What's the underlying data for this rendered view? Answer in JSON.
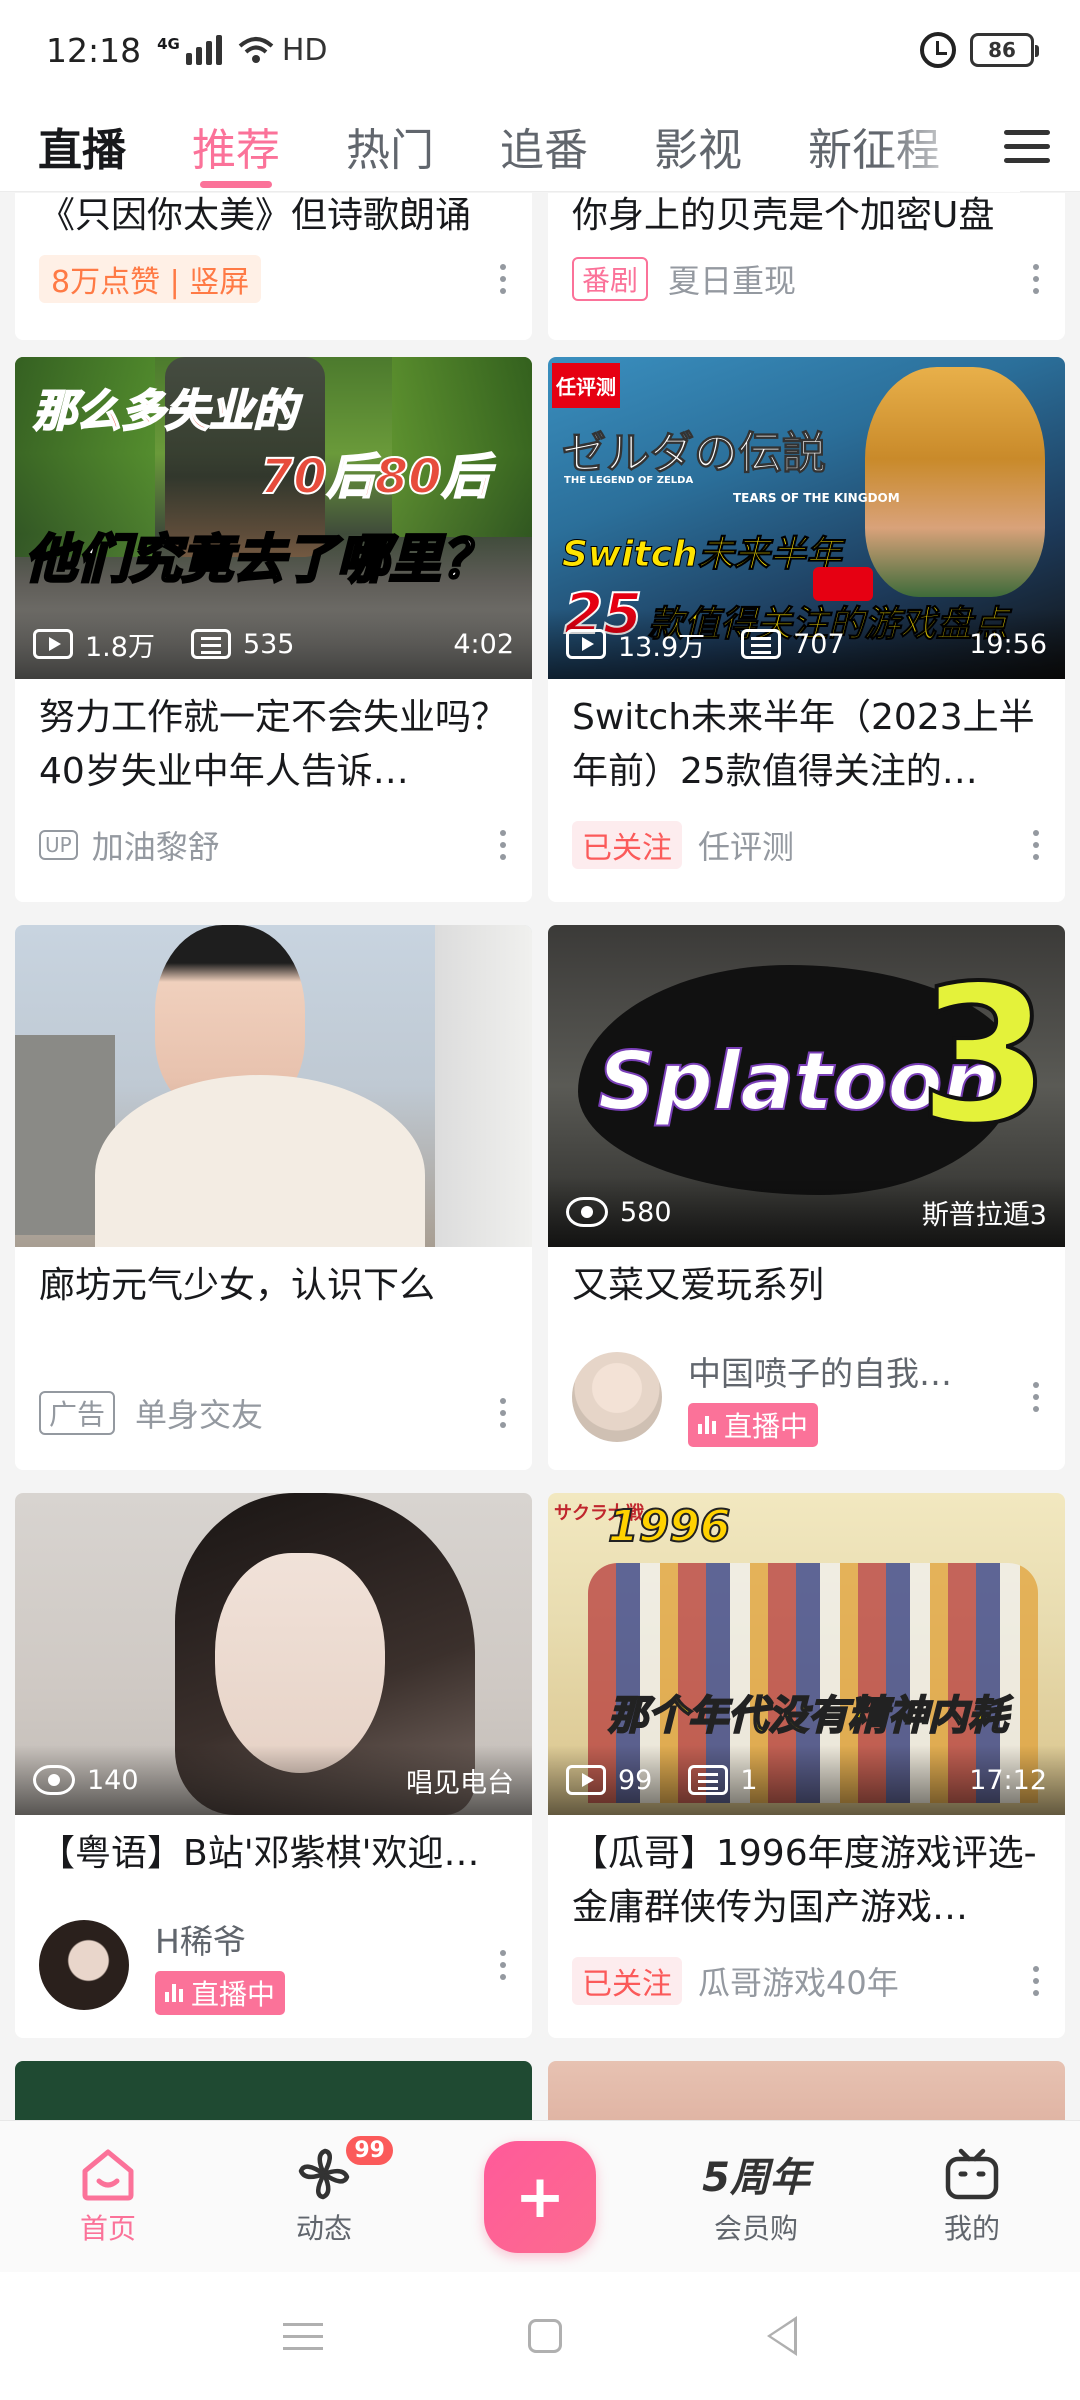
{
  "status_bar": {
    "time": "12:18",
    "network": "4G",
    "wifi": "HD",
    "battery": "86"
  },
  "nav": {
    "tabs": [
      "直播",
      "推荐",
      "热门",
      "追番",
      "影视",
      "新征程"
    ],
    "active": "推荐"
  },
  "feed": {
    "top_cards": [
      {
        "title": "《只因你太美》但诗歌朗诵",
        "tag": "8万点赞 | 竖屏"
      },
      {
        "title": "你身上的贝壳是个加密U盘",
        "tag": "番剧",
        "author": "夏日重现"
      }
    ],
    "cards": [
      {
        "thumb_lines": [
          "那么多失业的",
          "70后80后",
          "他们究竟去了哪里？"
        ],
        "plays": "1.8万",
        "danmaku": "535",
        "duration": "4:02",
        "title": "努力工作就一定不会失业吗？40岁失业中年人告诉…",
        "tag": "UP",
        "author": "加油黎舒"
      },
      {
        "thumb_lines": [
          "任评测",
          "ゼルダの伝説",
          "THE LEGEND OF ZELDA",
          "TEARS OF THE KINGDOM",
          "Switch未来半年",
          "25",
          "款值得关注的游戏盘点"
        ],
        "plays": "13.9万",
        "danmaku": "707",
        "duration": "19:56",
        "title": "Switch未来半年（2023上半年前）25款值得关注的…",
        "tag": "已关注",
        "author": "任评测"
      },
      {
        "title": "廊坊元气少女，认识下么",
        "tag": "广告",
        "author": "单身交友"
      },
      {
        "thumb_lines": [
          "Splatoon",
          "3"
        ],
        "views": "580",
        "right_label": "斯普拉遁3",
        "title": "又菜又爱玩系列",
        "author": "中国喷子的自我…",
        "live": "直播中"
      },
      {
        "views": "140",
        "right_label": "唱见电台",
        "title": "【粤语】B站'邓紫棋'欢迎…",
        "author": "H稀爷",
        "live": "直播中"
      },
      {
        "thumb_lines": [
          "サクラ大戦",
          "1996",
          "那个年代没有精神内耗"
        ],
        "plays": "99",
        "danmaku": "1",
        "duration": "17:12",
        "title": "【瓜哥】1996年度游戏评选-金庸群侠传为国产游戏…",
        "tag": "已关注",
        "author": "瓜哥游戏40年"
      }
    ]
  },
  "bottom_tabs": [
    {
      "label": "首页",
      "icon": "home-icon"
    },
    {
      "label": "动态",
      "icon": "dynamic-icon",
      "badge": "99"
    },
    {
      "label": "",
      "icon": "plus-icon"
    },
    {
      "label": "会员购",
      "icon": "5th-anniversary-icon",
      "icon_text": "5周年"
    },
    {
      "label": "我的",
      "icon": "tv-icon"
    }
  ],
  "colors": {
    "accent": "#fb7299",
    "follow": "#fb5a5a",
    "likes": "#ff7a45"
  }
}
